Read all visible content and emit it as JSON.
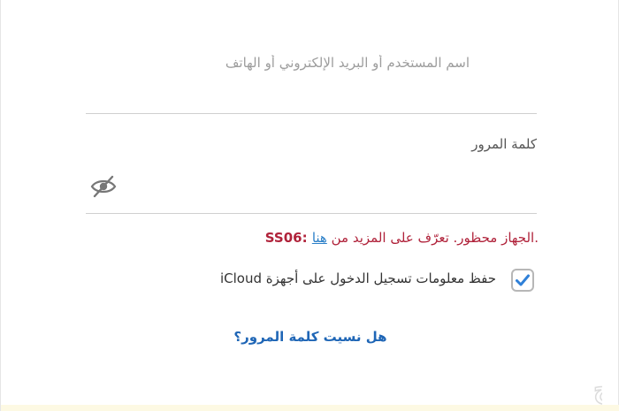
{
  "form": {
    "username_placeholder": "اسم المستخدم أو البريد الإلكتروني أو الهاتف",
    "password_label": "كلمة المرور",
    "password_value": "",
    "error": {
      "prefix": ".الجهاز محظور. تعرّف على المزيد من ",
      "link_text": "هنا",
      "code": " :SS06"
    },
    "remember": {
      "checked": true,
      "label": "حفظ معلومات تسجيل الدخول على أجهزة iCloud"
    },
    "forgot_link": "هل نسيت كلمة المرور؟"
  },
  "watermark": {
    "text": "حراج"
  },
  "colors": {
    "error": "#b0223a",
    "link": "#1f66b6",
    "check": "#2f80d8",
    "divider": "#cfcfcf"
  }
}
